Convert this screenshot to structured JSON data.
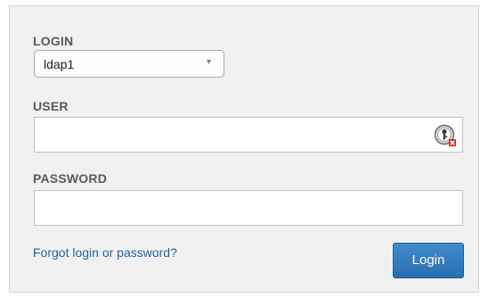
{
  "login_form": {
    "login_label": "LOGIN",
    "login_select": {
      "selected": "ldap1"
    },
    "user_label": "USER",
    "user_input": {
      "value": "",
      "icon": "keepass-key-icon"
    },
    "password_label": "PASSWORD",
    "password_input": {
      "value": ""
    },
    "forgot_link": "Forgot login or password?",
    "login_button": "Login"
  },
  "colors": {
    "panel_background": "#f1f1f1",
    "label_text": "#5a5a5a",
    "link": "#2563a8",
    "button": "#2f78bd",
    "icon_badge": "#d9261c"
  }
}
